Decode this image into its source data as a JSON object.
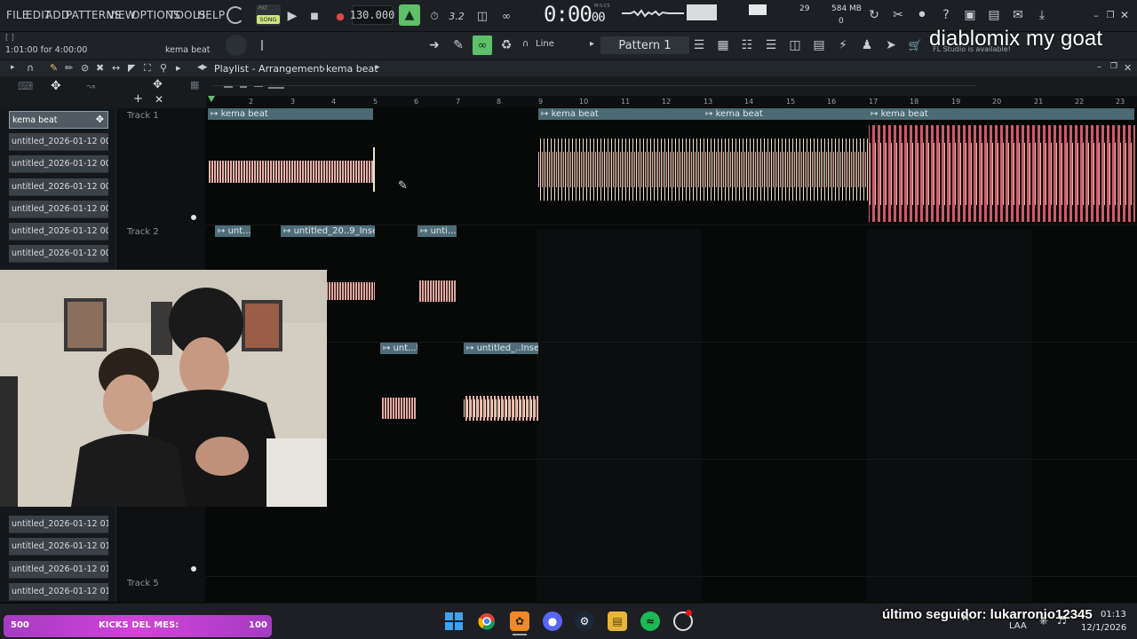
{
  "menu": [
    "FILE",
    "EDIT",
    "ADD",
    "PATTERNS",
    "VIEW",
    "OPTIONS",
    "TOOLS",
    "HELP"
  ],
  "transport": {
    "mode_pat": "PAT",
    "mode_song": "SONG",
    "tempo": "130.000",
    "time_main": "0:00",
    "time_small": "00",
    "time_unit": "M:S:CS",
    "cpu": "29",
    "mem": "584 MB",
    "poly": "0"
  },
  "hint_bar": {
    "position": "1:01:00 for 4:00:00",
    "pattern_name": "kema beat",
    "brackets": "[ ]"
  },
  "toolbar2": {
    "snap": "Line",
    "pattern": "Pattern 1",
    "update_notice": "FL Studio is available!"
  },
  "playlist": {
    "title": "Playlist - Arrangement",
    "crumb": "kema beat",
    "ruler": [
      "2",
      "3",
      "4",
      "5",
      "6",
      "7",
      "8",
      "9",
      "10",
      "11",
      "12",
      "13",
      "14",
      "15",
      "16",
      "17",
      "18",
      "19",
      "20",
      "21",
      "22",
      "23"
    ],
    "tracks": [
      "Track 1",
      "Track 2",
      "Track 5"
    ],
    "clips": [
      {
        "label": "kema beat"
      },
      {
        "label": "kema beat"
      },
      {
        "label": "kema beat"
      },
      {
        "label": "kema beat"
      },
      {
        "label": "unt...1"
      },
      {
        "label": "untitled_20..9_Insert 1"
      },
      {
        "label": "unti...t 1"
      },
      {
        "label": "unt...t 1"
      },
      {
        "label": "untitled_..Insert 1"
      }
    ]
  },
  "picker": {
    "items": [
      "kema beat",
      "untitled_2026-01-12 00-...",
      "untitled_2026-01-12 00-...",
      "untitled_2026-01-12 00-...",
      "untitled_2026-01-12 00-...",
      "untitled_2026-01-12 00-...",
      "untitled_2026-01-12 00-...",
      "untitled_2026-01-12 01-...",
      "untitled_2026-01-12 01-...",
      "untitled_2026-01-12 01-...",
      "untitled_2026-01-12 01-..."
    ]
  },
  "overlay": {
    "title": "diablomix my goat",
    "follower": "último seguidor: lukarronio12345",
    "kicks_left": "500",
    "kicks_label": "KICKS DEL MES:",
    "kicks_right": "100"
  },
  "taskbar": {
    "time": "01:13",
    "date": "12/1/2026",
    "lang": "LAA"
  },
  "colors": {
    "clip_header": "#4b6a73",
    "wave_pink": "#e8a5a5",
    "wave_cream": "#efe6c8",
    "wave_red": "#d05a63",
    "accent_green": "#5fbf6a",
    "kicks_magenta": "#c33dd2"
  }
}
